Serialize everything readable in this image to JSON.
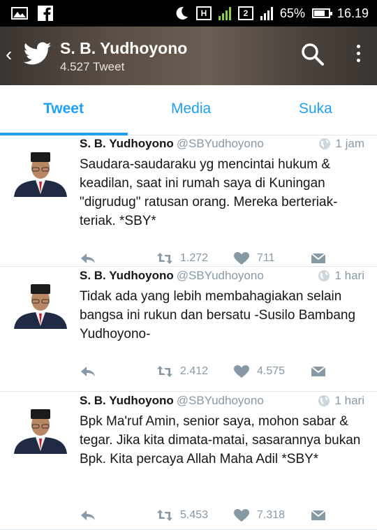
{
  "status_bar": {
    "battery": "65%",
    "time": "16.19",
    "net_h": "H",
    "net_2": "2"
  },
  "header": {
    "name": "S. B. Yudhoyono",
    "tweet_count": "4.527 Tweet"
  },
  "tabs": [
    {
      "label": "Tweet"
    },
    {
      "label": "Media"
    },
    {
      "label": "Suka"
    }
  ],
  "tweets": [
    {
      "name": "S. B. Yudhoyono",
      "handle": "@SBYudhoyono",
      "time": "1 jam",
      "text": "Saudara-saudaraku yg mencintai hukum & keadilan, saat ini rumah saya di Kuningan \"digrudug\" ratusan orang. Mereka berteriak-teriak. *SBY*",
      "retweets": "1.272",
      "likes": "711"
    },
    {
      "name": "S. B. Yudhoyono",
      "handle": "@SBYudhoyono",
      "time": "1 hari",
      "text": "Tidak ada yang lebih membahagiakan selain bangsa ini rukun dan bersatu -Susilo Bambang Yudhoyono-",
      "retweets": "2.412",
      "likes": "4.575"
    },
    {
      "name": "S. B. Yudhoyono",
      "handle": "@SBYudhoyono",
      "time": "1 hari",
      "text": "Bpk Ma'ruf Amin, senior saya, mohon sabar & tegar. Jika kita dimata-matai, sasarannya bukan Bpk. Kita percaya Allah Maha Adil *SBY*",
      "retweets": "5.453",
      "likes": "7.318"
    }
  ],
  "colors": {
    "accent": "#1da1f2",
    "muted": "#8899a6"
  }
}
